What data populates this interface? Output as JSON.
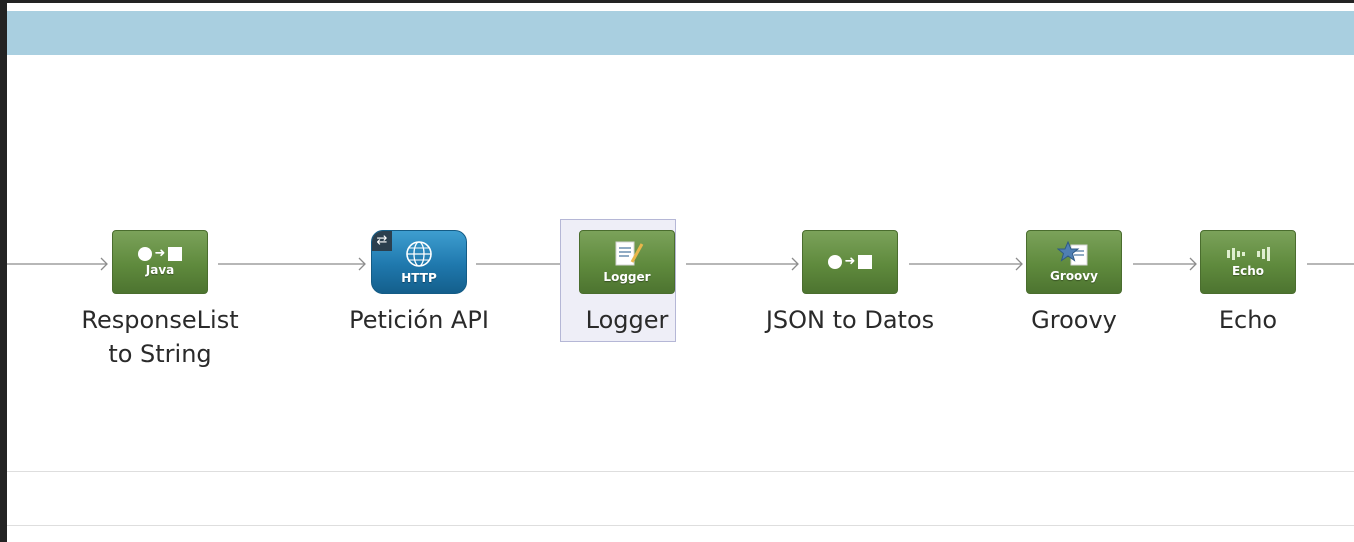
{
  "flow": {
    "nodes": [
      {
        "id": "responselist",
        "icon": "java-transformer-icon",
        "icon_caption": "Java",
        "label_lines": [
          "ResponseList",
          "to String"
        ]
      },
      {
        "id": "peticion",
        "icon": "http-globe-icon",
        "icon_caption": "HTTP",
        "label_lines": [
          "Petición API"
        ]
      },
      {
        "id": "logger",
        "icon": "logger-document-icon",
        "icon_caption": "Logger",
        "label_lines": [
          "Logger"
        ],
        "selected": true
      },
      {
        "id": "json",
        "icon": "transformer-icon",
        "icon_caption": "",
        "label_lines": [
          "JSON to Datos"
        ]
      },
      {
        "id": "groovy",
        "icon": "groovy-star-icon",
        "icon_caption": "Groovy",
        "label_lines": [
          "Groovy"
        ]
      },
      {
        "id": "echo",
        "icon": "echo-wave-icon",
        "icon_caption": "Echo",
        "label_lines": [
          "Echo"
        ]
      }
    ]
  },
  "colors": {
    "header_bar": "#a9cfe0",
    "processor_green": "#5f8a3d",
    "http_blue": "#1f78ad",
    "selection": "#eeeef7",
    "connector": "#8c8c8c"
  }
}
